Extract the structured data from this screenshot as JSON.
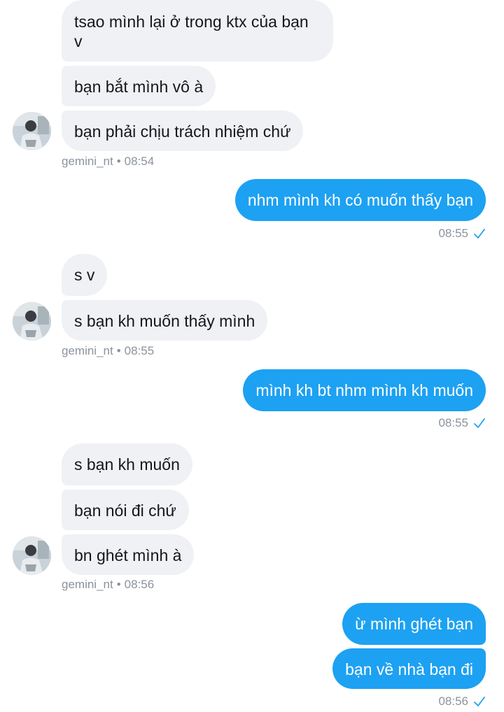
{
  "colors": {
    "incoming_bubble": "#eff1f4",
    "outgoing_bubble": "#1da1f2",
    "meta_text": "#8a939c",
    "check": "#1da1f2"
  },
  "messages": {
    "g1": {
      "m1": "tsao mình lại ở trong ktx của bạn v",
      "m2": "bạn bắt mình vô à",
      "m3": "bạn phải chịu trách nhiệm chứ",
      "sender": "gemini_nt",
      "time": "08:54"
    },
    "o1": {
      "m1": "nhm mình kh có muốn thấy bạn",
      "time": "08:55"
    },
    "g2": {
      "m1": "s v",
      "m2": "s bạn kh muốn thấy mình",
      "sender": "gemini_nt",
      "time": "08:55"
    },
    "o2": {
      "m1": "mình kh bt nhm mình kh muốn",
      "time": "08:55"
    },
    "g3": {
      "m1": "s bạn kh muốn",
      "m2": "bạn nói đi chứ",
      "m3": "bn ghét mình à",
      "sender": "gemini_nt",
      "time": "08:56"
    },
    "o3": {
      "m1": "ừ mình ghét bạn",
      "m2": "bạn về nhà bạn đi",
      "time": "08:56"
    }
  },
  "separator": "•",
  "icons": {
    "avatar": "user-avatar",
    "read_receipt": "checkmark-icon"
  }
}
